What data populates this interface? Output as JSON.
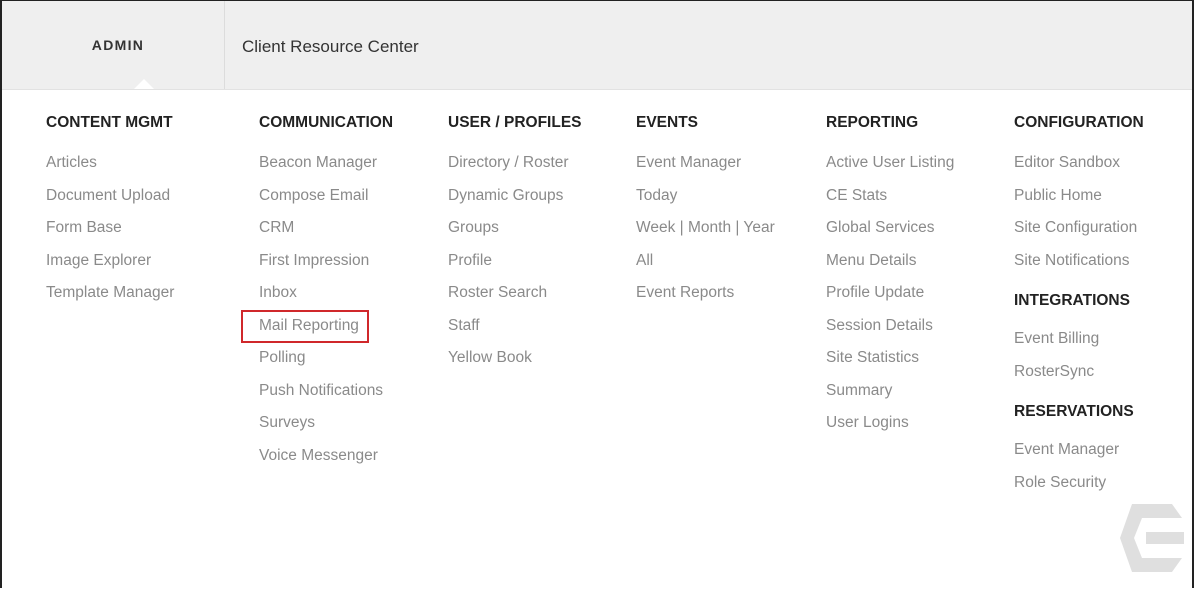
{
  "topbar": {
    "admin_label": "ADMIN",
    "crc_label": "Client Resource Center"
  },
  "menu": {
    "columns": [
      {
        "heading": "CONTENT MGMT",
        "items": [
          "Articles",
          "Document Upload",
          "Form Base",
          "Image Explorer",
          "Template Manager"
        ]
      },
      {
        "heading": "COMMUNICATION",
        "items": [
          "Beacon Manager",
          "Compose Email",
          "CRM",
          "First Impression",
          "Inbox",
          "Mail Reporting",
          "Polling",
          "Push Notifications",
          "Surveys",
          "Voice Messenger"
        ],
        "highlighted_item": "Mail Reporting"
      },
      {
        "heading": "USER / PROFILES",
        "items": [
          "Directory / Roster",
          "Dynamic Groups",
          "Groups",
          "Profile",
          "Roster Search",
          "Staff",
          "Yellow Book"
        ]
      },
      {
        "heading": "EVENTS",
        "items": [
          "Event Manager",
          "Today",
          "Week | Month | Year",
          "All",
          "Event Reports"
        ]
      },
      {
        "heading": "REPORTING",
        "items": [
          "Active User Listing",
          "CE Stats",
          "Global Services",
          "Menu Details",
          "Profile Update",
          "Session Details",
          "Site Statistics",
          "Summary",
          "User Logins"
        ]
      },
      {
        "heading": "CONFIGURATION",
        "items": [
          "Editor Sandbox",
          "Public Home",
          "Site Configuration",
          "Site Notifications"
        ],
        "subsections": [
          {
            "heading": "INTEGRATIONS",
            "items": [
              "Event Billing",
              "RosterSync"
            ]
          },
          {
            "heading": "RESERVATIONS",
            "items": [
              "Event Manager",
              "Role Security"
            ]
          }
        ]
      }
    ]
  },
  "colors": {
    "highlight_border": "#d0282b",
    "item_text": "#8a8a8a",
    "heading_text": "#222222",
    "topbar_bg": "#efefef"
  },
  "icons": {
    "watermark": "brand-logo-icon",
    "active_caret": "caret-up-icon"
  }
}
